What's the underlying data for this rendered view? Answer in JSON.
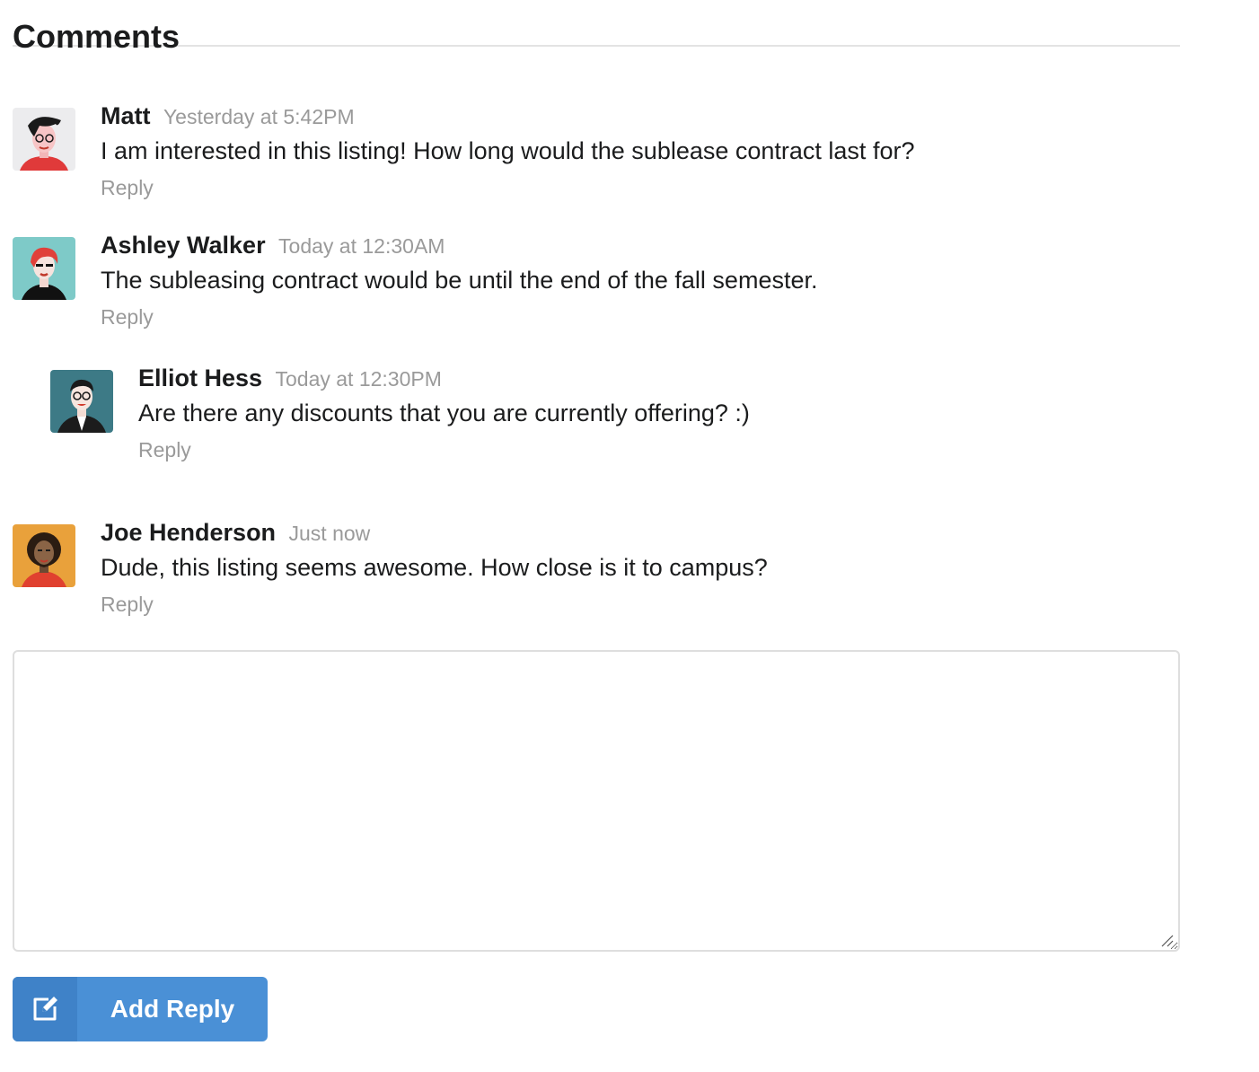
{
  "section": {
    "title": "Comments"
  },
  "comments": [
    {
      "author": "Matt",
      "timestamp": "Yesterday at 5:42PM",
      "text": "I am interested in this listing! How long would the sublease contract last for?",
      "reply_label": "Reply",
      "avatar_icon": "man-avatar-icon"
    },
    {
      "author": "Ashley Walker",
      "timestamp": "Today at 12:30AM",
      "text": "The subleasing contract would be until the end of the fall semester.",
      "reply_label": "Reply",
      "avatar_icon": "woman-avatar-icon"
    },
    {
      "author": "Elliot Hess",
      "timestamp": "Today at 12:30PM",
      "text": "Are there any discounts that you are currently offering? :)",
      "reply_label": "Reply",
      "avatar_icon": "man-glasses-avatar-icon"
    },
    {
      "author": "Joe Henderson",
      "timestamp": "Just now",
      "text": "Dude, this listing seems awesome. How close is it to campus?",
      "reply_label": "Reply",
      "avatar_icon": "man-beard-avatar-icon"
    }
  ],
  "reply_form": {
    "placeholder": "",
    "value": "",
    "button_label": "Add Reply",
    "button_icon": "edit-icon"
  },
  "colors": {
    "button_blue": "#4a90d6",
    "button_icon_bg": "#3f82c8",
    "muted_text": "#9a9a9a",
    "divider": "#e3e3e3"
  }
}
